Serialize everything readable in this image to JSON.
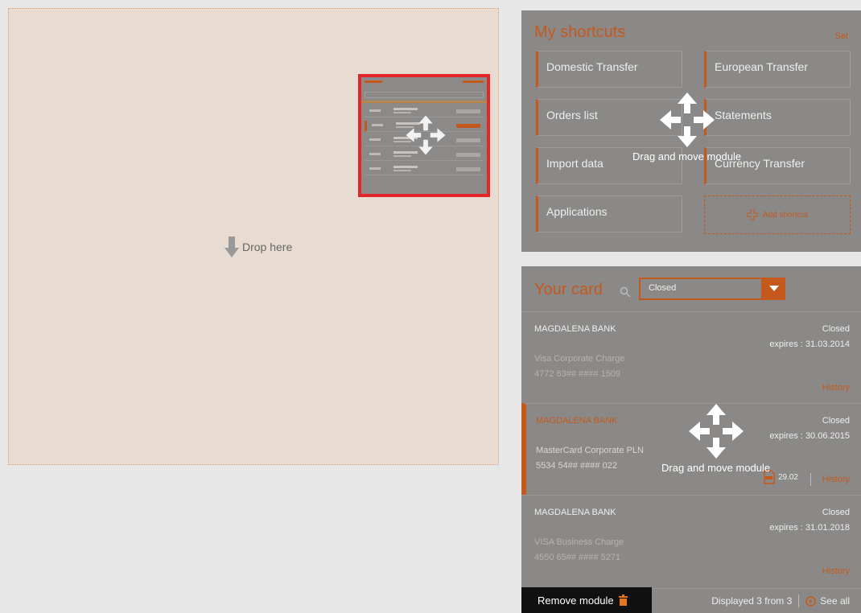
{
  "drop_zone": {
    "label": "Drop here"
  },
  "shortcuts": {
    "title": "My shortcuts",
    "settings_label": "Set",
    "items": [
      "Domestic Transfer",
      "European Transfer",
      "Orders list",
      "Statements",
      "Import data",
      "Currency Transfer",
      "Applications"
    ],
    "add_label": "Add shortcut"
  },
  "drag_overlay": {
    "text": "Drag and move module"
  },
  "card": {
    "title": "Your card",
    "filter_value": "Closed",
    "items": [
      {
        "name": "MAGDALENA BANK",
        "status": "Closed",
        "expires": "expires : 31.03.2014",
        "type": "Visa Corporate Charge",
        "number": "4772 63## #### 1509",
        "history": "History"
      },
      {
        "name": "MAGDALENA BANK",
        "status": "Closed",
        "expires": "expires : 30.06.2015",
        "type": "MasterCard Corporate PLN",
        "number": "5534 54## #### 022",
        "history": "History",
        "pdf_date": "29.02"
      },
      {
        "name": "MAGDALENA BANK",
        "status": "Closed",
        "expires": "expires : 31.01.2018",
        "type": "VISA Business Charge",
        "number": "4550 65## #### 5271",
        "history": "History"
      }
    ],
    "displayed": "Displayed 3 from 3",
    "see_all": "See all"
  },
  "remove_module": {
    "label": "Remove module"
  },
  "colors": {
    "accent": "#c4581d",
    "module_bg": "#8b8987",
    "drop_bg": "#e8dbd1",
    "thumb_border": "#e2262a"
  }
}
